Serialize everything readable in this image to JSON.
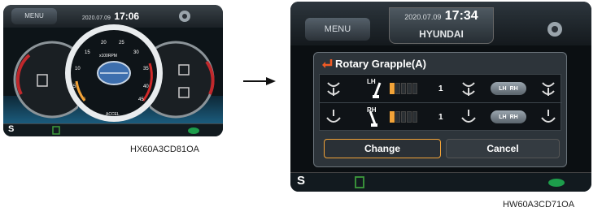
{
  "left_screen": {
    "menu_label": "MENU",
    "date": "2020.07.09",
    "time": "17:06",
    "rpm_unit": "x100RPM",
    "accel_label": "ACCEL",
    "tick_labels": [
      "5",
      "10",
      "15",
      "20",
      "25",
      "30",
      "35",
      "40",
      "45",
      "0"
    ],
    "status_letter": "S",
    "caption": "HX60A3CD81OA"
  },
  "right_screen": {
    "menu_label": "MENU",
    "date": "2020.07.09",
    "time": "17:34",
    "brand": "HYUNDAI",
    "panel_title": "Rotary Grapple(A)",
    "rows": [
      {
        "side_label": "LH",
        "level": "1",
        "toggle_left": "LH",
        "toggle_right": "RH"
      },
      {
        "side_label": "RH",
        "level": "1",
        "toggle_left": "LH",
        "toggle_right": "RH"
      }
    ],
    "change_label": "Change",
    "cancel_label": "Cancel",
    "status_letter": "S",
    "caption": "HW60A3CD71OA"
  },
  "colors": {
    "accent_orange": "#f2a338",
    "bar_green": "#3c9b3c",
    "turtle_green": "#1d9d4b"
  }
}
